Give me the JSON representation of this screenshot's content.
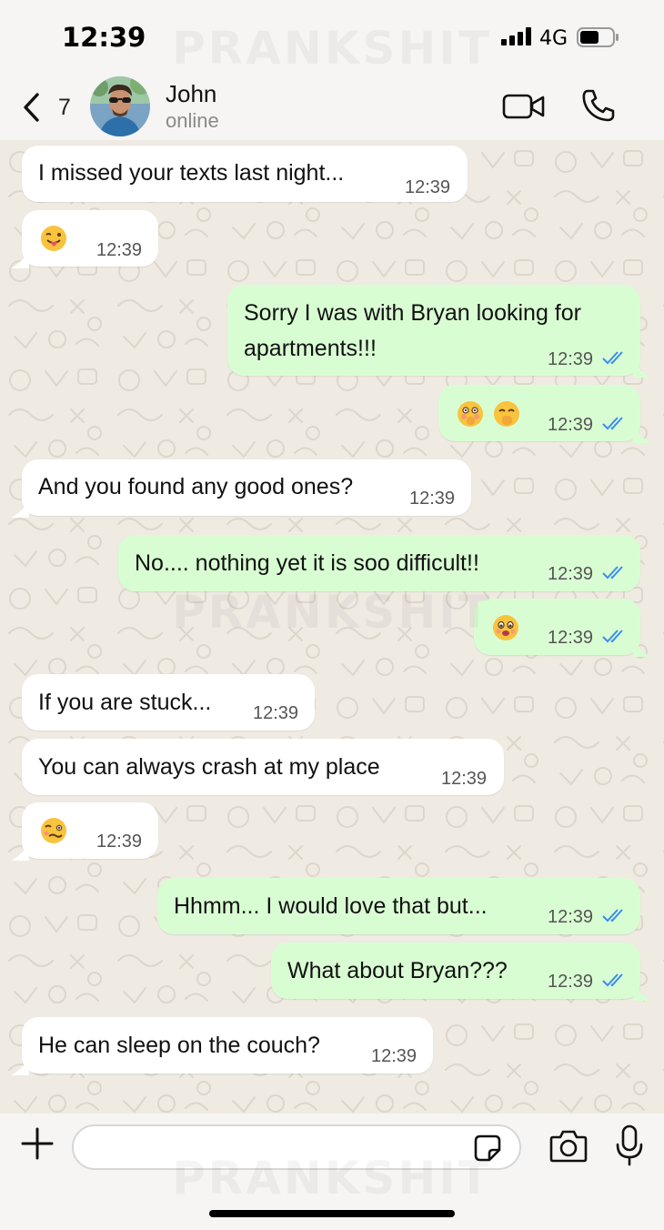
{
  "watermark": "PRANKSHIT",
  "status_bar": {
    "time": "12:39",
    "network": "4G"
  },
  "header": {
    "unread_count": "7",
    "contact_name": "John",
    "contact_status": "online"
  },
  "messages": [
    {
      "dir": "in",
      "text": "I missed your texts last night...",
      "time": "12:39"
    },
    {
      "dir": "in",
      "emoji": "face-with-tongue-wink",
      "time": "12:39"
    },
    {
      "dir": "out",
      "text_line1": "Sorry I was with Bryan looking for",
      "text_line2": "apartments!!!",
      "time": "12:39",
      "read": true
    },
    {
      "dir": "out",
      "emoji": "flushed-face-with-hand, face-with-hand-over-mouth",
      "time": "12:39",
      "read": true
    },
    {
      "dir": "in",
      "text": "And you found any good ones?",
      "time": "12:39"
    },
    {
      "dir": "out",
      "text": "No.... nothing yet it is soo difficult!!",
      "time": "12:39",
      "read": true
    },
    {
      "dir": "out",
      "emoji": "face-holding-back-tears",
      "time": "12:39",
      "read": true
    },
    {
      "dir": "in",
      "text": "If you are stuck...",
      "time": "12:39"
    },
    {
      "dir": "in",
      "text": "You can always crash at my place",
      "time": "12:39"
    },
    {
      "dir": "in",
      "emoji": "woozy-face",
      "time": "12:39"
    },
    {
      "dir": "out",
      "text": "Hhmm... I would love that but...",
      "time": "12:39",
      "read": true
    },
    {
      "dir": "out",
      "text": "What about Bryan???",
      "time": "12:39",
      "read": true
    },
    {
      "dir": "in",
      "text": "He can sleep on the couch?",
      "time": "12:39"
    }
  ],
  "input": {
    "value": "",
    "placeholder": ""
  },
  "colors": {
    "outgoing_bubble": "#d9fdd3",
    "incoming_bubble": "#ffffff",
    "read_ticks": "#3b8cf0",
    "chat_background": "#efeae2"
  }
}
